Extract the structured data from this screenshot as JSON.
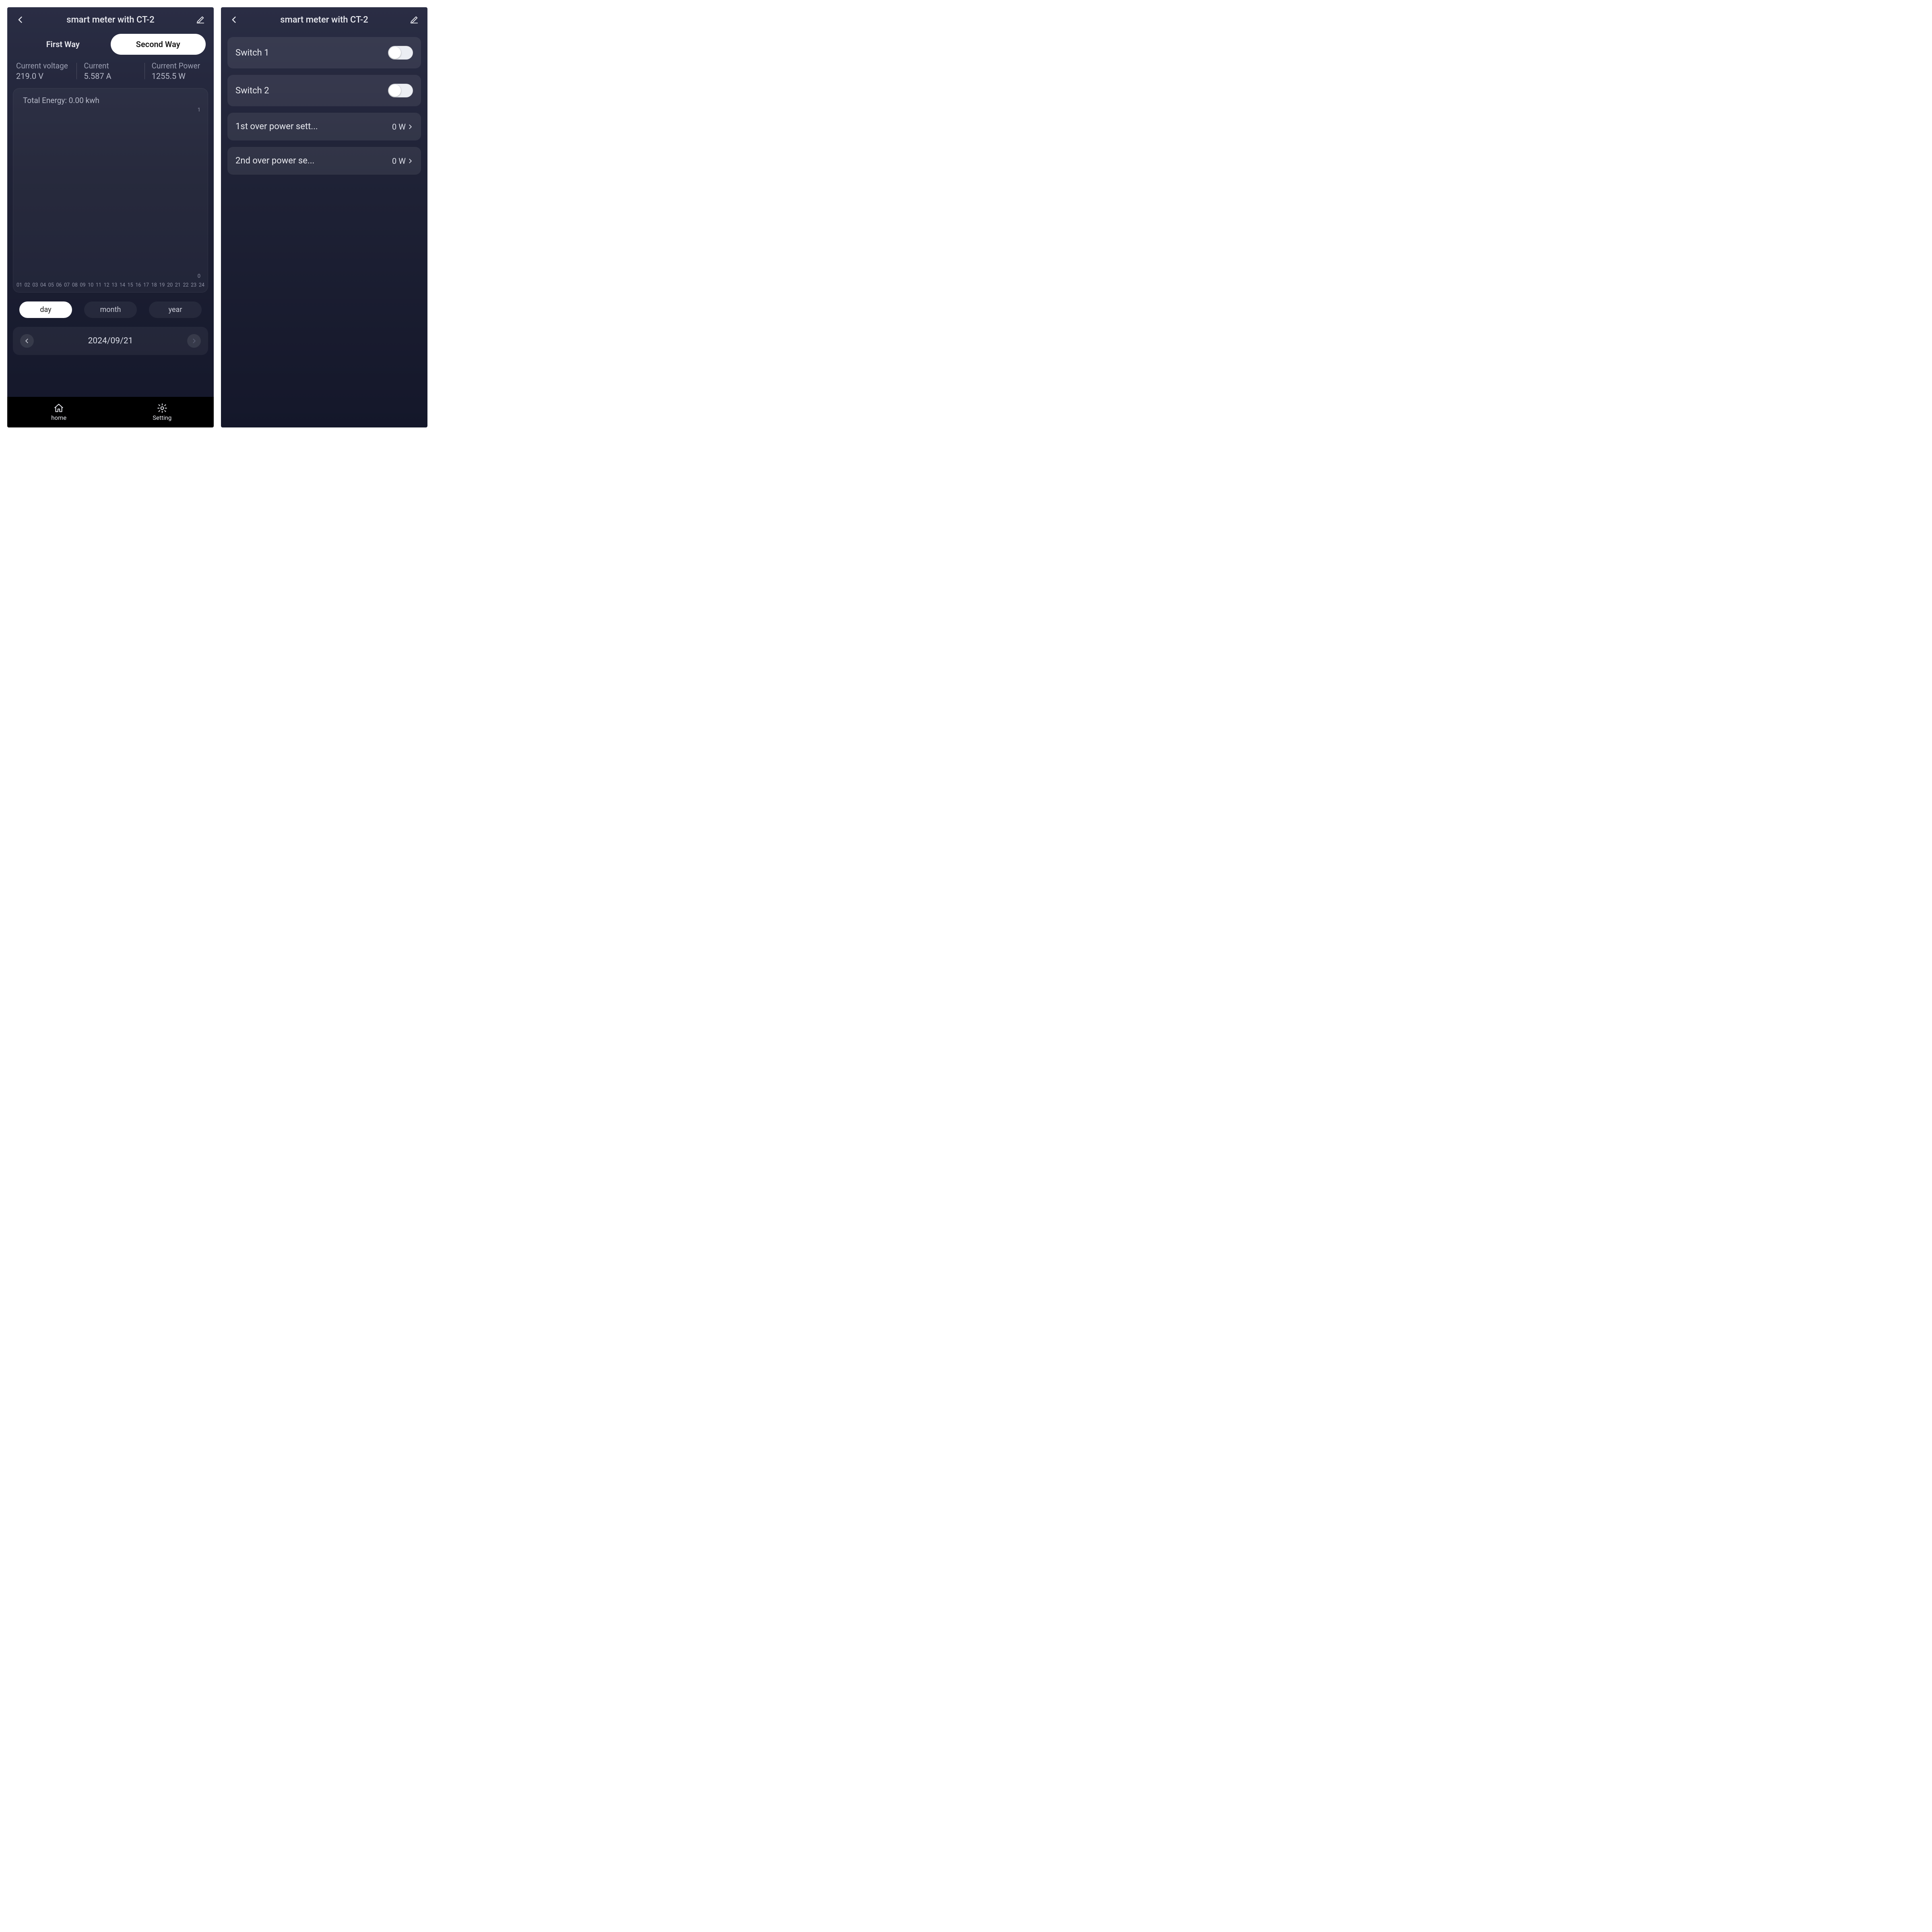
{
  "left": {
    "title": "smart meter with CT-2",
    "tabs": {
      "first": "First Way",
      "second": "Second Way",
      "active": "second"
    },
    "metrics": {
      "voltage": {
        "label": "Current voltage",
        "value": "219.0 V"
      },
      "current": {
        "label": "Current",
        "value": "5.587 A"
      },
      "power": {
        "label": "Current Power",
        "value": "1255.5 W"
      }
    },
    "chart": {
      "title": "Total Energy: 0.00 kwh"
    },
    "period": {
      "day": "day",
      "month": "month",
      "year": "year",
      "active": "day"
    },
    "date": "2024/09/21",
    "bottom": {
      "home": "home",
      "setting": "Setting"
    }
  },
  "right": {
    "title": "smart meter with CT-2",
    "rows": {
      "sw1": {
        "label": "Switch 1",
        "on": false
      },
      "sw2": {
        "label": "Switch 2",
        "on": false
      },
      "op1": {
        "label": "1st over power sett...",
        "value": "0 W"
      },
      "op2": {
        "label": "2nd over power se...",
        "value": "0 W"
      }
    }
  },
  "chart_data": {
    "type": "bar",
    "title": "Total Energy: 0.00 kwh",
    "xlabel": "",
    "ylabel": "",
    "ylim": [
      0,
      1
    ],
    "categories": [
      "01",
      "02",
      "03",
      "04",
      "05",
      "06",
      "07",
      "08",
      "09",
      "10",
      "11",
      "12",
      "13",
      "14",
      "15",
      "16",
      "17",
      "18",
      "19",
      "20",
      "21",
      "22",
      "23",
      "24"
    ],
    "values": [
      0,
      0,
      0,
      0,
      0,
      0,
      0,
      0,
      0,
      0,
      0,
      0,
      0,
      0,
      0,
      0,
      0,
      0,
      0,
      0,
      0,
      0,
      0,
      0
    ]
  }
}
